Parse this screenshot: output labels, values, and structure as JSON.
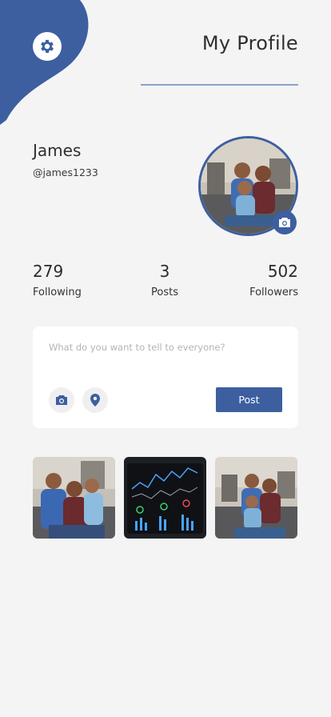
{
  "header": {
    "title": "My Profile",
    "settings_icon": "gear-icon"
  },
  "profile": {
    "name": "James",
    "handle": "@james1233",
    "avatar": "family-photo",
    "camera_icon": "camera-icon"
  },
  "stats": [
    {
      "value": "279",
      "label": "Following"
    },
    {
      "value": "3",
      "label": "Posts"
    },
    {
      "value": "502",
      "label": "Followers"
    }
  ],
  "composer": {
    "placeholder": "What do you want to tell to everyone?",
    "value": "",
    "post_label": "Post",
    "camera_icon": "camera-icon",
    "location_icon": "location-pin-icon"
  },
  "gallery": [
    {
      "subject": "family-portrait-sofa"
    },
    {
      "subject": "stock-chart-tablet"
    },
    {
      "subject": "family-portrait-sofa"
    }
  ],
  "colors": {
    "accent": "#3d5fa0",
    "background": "#f4f4f5",
    "card": "#ffffff",
    "rule": "#8aa2c8"
  }
}
